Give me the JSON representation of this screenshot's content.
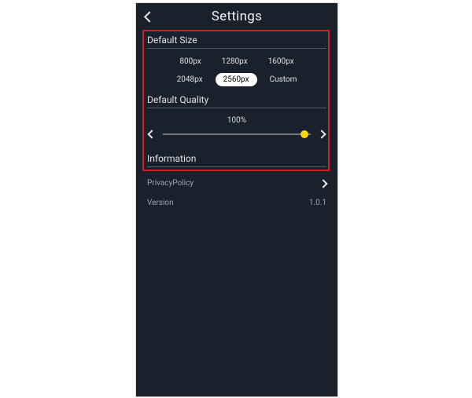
{
  "header": {
    "title": "Settings"
  },
  "size": {
    "heading": "Default Size",
    "options": [
      "800px",
      "1280px",
      "1600px",
      "2048px",
      "2560px",
      "Custom"
    ],
    "selected": "2560px"
  },
  "quality": {
    "heading": "Default Quality",
    "value_label": "100%",
    "percent": 96
  },
  "info": {
    "heading": "Information",
    "privacy_label": "PrivacyPolicy",
    "version_label": "Version",
    "version_value": "1.0.1"
  },
  "colors": {
    "panel_bg": "#1a212d",
    "highlight_border": "#d21f1f",
    "slider_thumb": "#f5d90a"
  }
}
